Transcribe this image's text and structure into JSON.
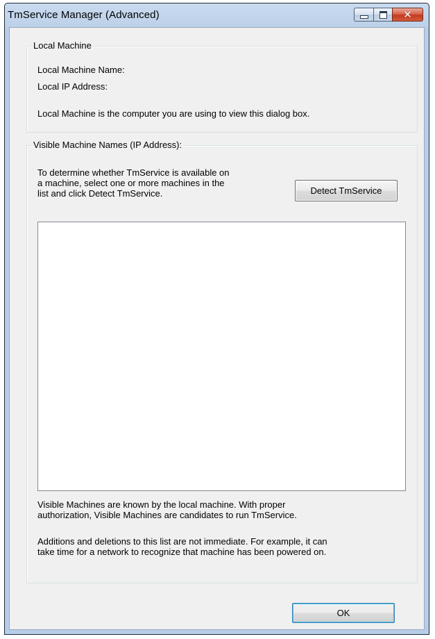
{
  "window": {
    "title": "TmService Manager (Advanced)",
    "minimize_icon": "minimize-icon",
    "maximize_icon": "maximize-icon",
    "close_icon": "close-icon",
    "close_glyph": "✕"
  },
  "local_machine": {
    "legend": "Local Machine",
    "name_label": "Local Machine Name:",
    "ip_label": "Local IP Address:",
    "description": "Local Machine is the computer you are using to view this dialog box."
  },
  "visible_machines": {
    "legend": "Visible Machine Names (IP Address):",
    "instructions": "To determine whether TmService is available on\na machine, select one or more machines in the\nlist and click Detect TmService.",
    "detect_button": "Detect TmService",
    "items": [],
    "note_known": "Visible Machines are known by the local machine. With proper\nauthorization, Visible Machines are candidates to run TmService.",
    "note_additions": "Additions and deletions to this list are not immediate. For example, it can\ntake time for a network to recognize that machine has been powered on."
  },
  "footer": {
    "ok_button": "OK"
  },
  "colors": {
    "titlebar": "#bcd0e9",
    "dialog_background": "#f0f0f0",
    "close_button": "#c43a1e",
    "listbox_background": "#ffffff"
  }
}
